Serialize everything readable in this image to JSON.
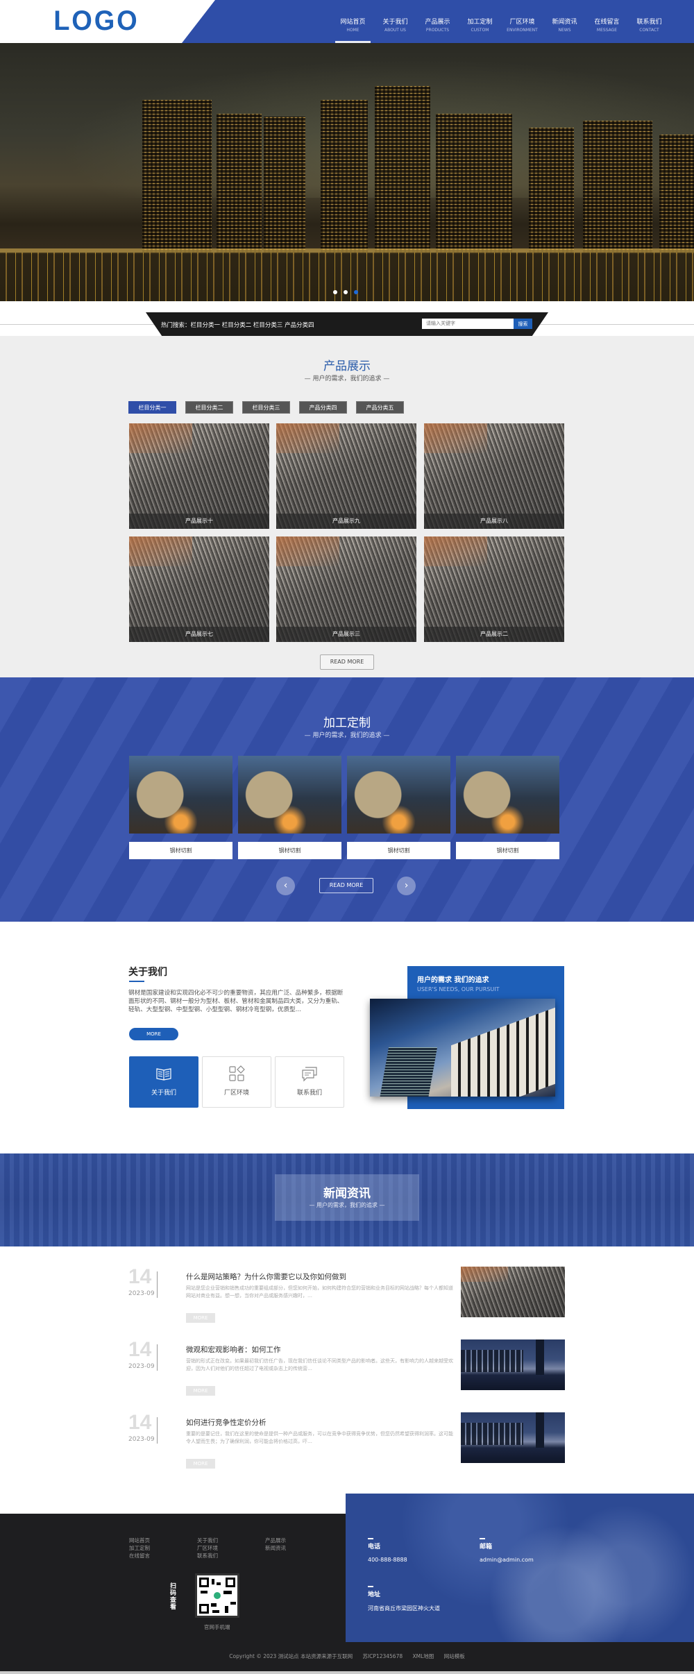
{
  "header": {
    "logo": "LOGO",
    "nav": [
      {
        "cn": "网站首页",
        "en": "HOME",
        "active": true
      },
      {
        "cn": "关于我们",
        "en": "ABOUT US"
      },
      {
        "cn": "产品展示",
        "en": "PRODUCTS"
      },
      {
        "cn": "加工定制",
        "en": "CUSTOM"
      },
      {
        "cn": "厂区环境",
        "en": "ENVIRONMENT"
      },
      {
        "cn": "新闻资讯",
        "en": "NEWS"
      },
      {
        "cn": "在线留言",
        "en": "MESSAGE"
      },
      {
        "cn": "联系我们",
        "en": "CONTACT"
      }
    ]
  },
  "banner": {
    "slides": 3,
    "active_slide": 3
  },
  "search": {
    "hot_label": "热门搜索：栏目分类一  栏目分类二  栏目分类三  产品分类四",
    "placeholder": "请输入关键字",
    "button": "搜索"
  },
  "products": {
    "title": "产品展示",
    "subtitle": "—  用户的需求，我们的追求  —",
    "tabs": [
      "栏目分类一",
      "栏目分类二",
      "栏目分类三",
      "产品分类四",
      "产品分类五"
    ],
    "active_tab": 0,
    "items": [
      "产品展示十",
      "产品展示九",
      "产品展示八",
      "产品展示七",
      "产品展示三",
      "产品展示二"
    ],
    "read_more": "READ MORE"
  },
  "custom": {
    "title": "加工定制",
    "subtitle": "—  用户的需求，我们的追求  —",
    "items": [
      "钢材切割",
      "钢材切割",
      "钢材切割",
      "钢材切割"
    ],
    "prev": "‹",
    "next": "›",
    "read_more": "READ MORE"
  },
  "about": {
    "title": "关于我们",
    "text": "钢材是国家建设和实现四化必不可少的重要物资，其应用广泛、品种繁多，根据断面形状的不同、钢材一般分为型材、板材、管材和金属制品四大类，又分为重轨、轻轨、大型型钢、中型型钢、小型型钢、钢材冷弯型钢，优质型...",
    "more": "MORE",
    "boxes": [
      {
        "label": "关于我们",
        "icon": "book-icon",
        "active": true
      },
      {
        "label": "厂区环境",
        "icon": "grid-icon"
      },
      {
        "label": "联系我们",
        "icon": "chat-icon"
      }
    ],
    "slogan": "用户的需求 我们的追求",
    "slogan_en": "USER'S NEEDS, OUR PURSUIT"
  },
  "news": {
    "title": "新闻资讯",
    "subtitle": "—  用户的需求，我们的追求  —",
    "items": [
      {
        "day": "14",
        "ym": "2023-09",
        "title": "什么是网站策略？为什么你需要它以及你如何做到",
        "desc": "网站是您企业营销和销售成功的重要组成部分，但您如何开始，如何构建符合您的营销和业务目标的网站战略？每个人都知道网站对商业有益。想一想，当你对产品或服务感兴趣时，…",
        "more": "MORE",
        "image": "steel"
      },
      {
        "day": "14",
        "ym": "2023-09",
        "title": "微观和宏观影响者：如何工作",
        "desc": "营销的形式正在改变。如果最初我们信任广告，现在我们信任谈论不同类型产品的影响者。这些天，有影响力的人越来越受欢迎，因为人们对他们的信任超过了电视或杂志上的传统营…",
        "more": "MORE",
        "image": "port"
      },
      {
        "day": "14",
        "ym": "2023-09",
        "title": "如何进行竞争性定价分析",
        "desc": "重要的是要记住，我们在这里的使命是提供一种产品或服务，可以在竞争中获得竞争优势，但您仍然希望获得利润率。这可能令人望而生畏；为了确保利润，你可能会将价格过高，吓…",
        "more": "MORE",
        "image": "port"
      }
    ]
  },
  "footer": {
    "links": [
      [
        "网站首页",
        "加工定制",
        "在线留言"
      ],
      [
        "关于我们",
        "厂区环境",
        "联系我们"
      ],
      [
        "产品展示",
        "新闻资讯"
      ]
    ],
    "qr_label": "扫码查看",
    "qr_caption": "官网手机端",
    "phone_label": "电话",
    "phone": "400-888-8888",
    "email_label": "邮箱",
    "email": "admin@admin.com",
    "address_label": "地址",
    "address": "河南省商丘市梁园区神火大道",
    "copyright": "Copyright © 2023 测试站点 本站资源来源于互联网",
    "icp": "苏ICP12345678",
    "sitemap": "XML地图",
    "template": "网站模板"
  },
  "colors": {
    "brand_blue": "#2f4ea8",
    "accent_blue": "#1e5fb8",
    "dark": "#1e1e20"
  }
}
